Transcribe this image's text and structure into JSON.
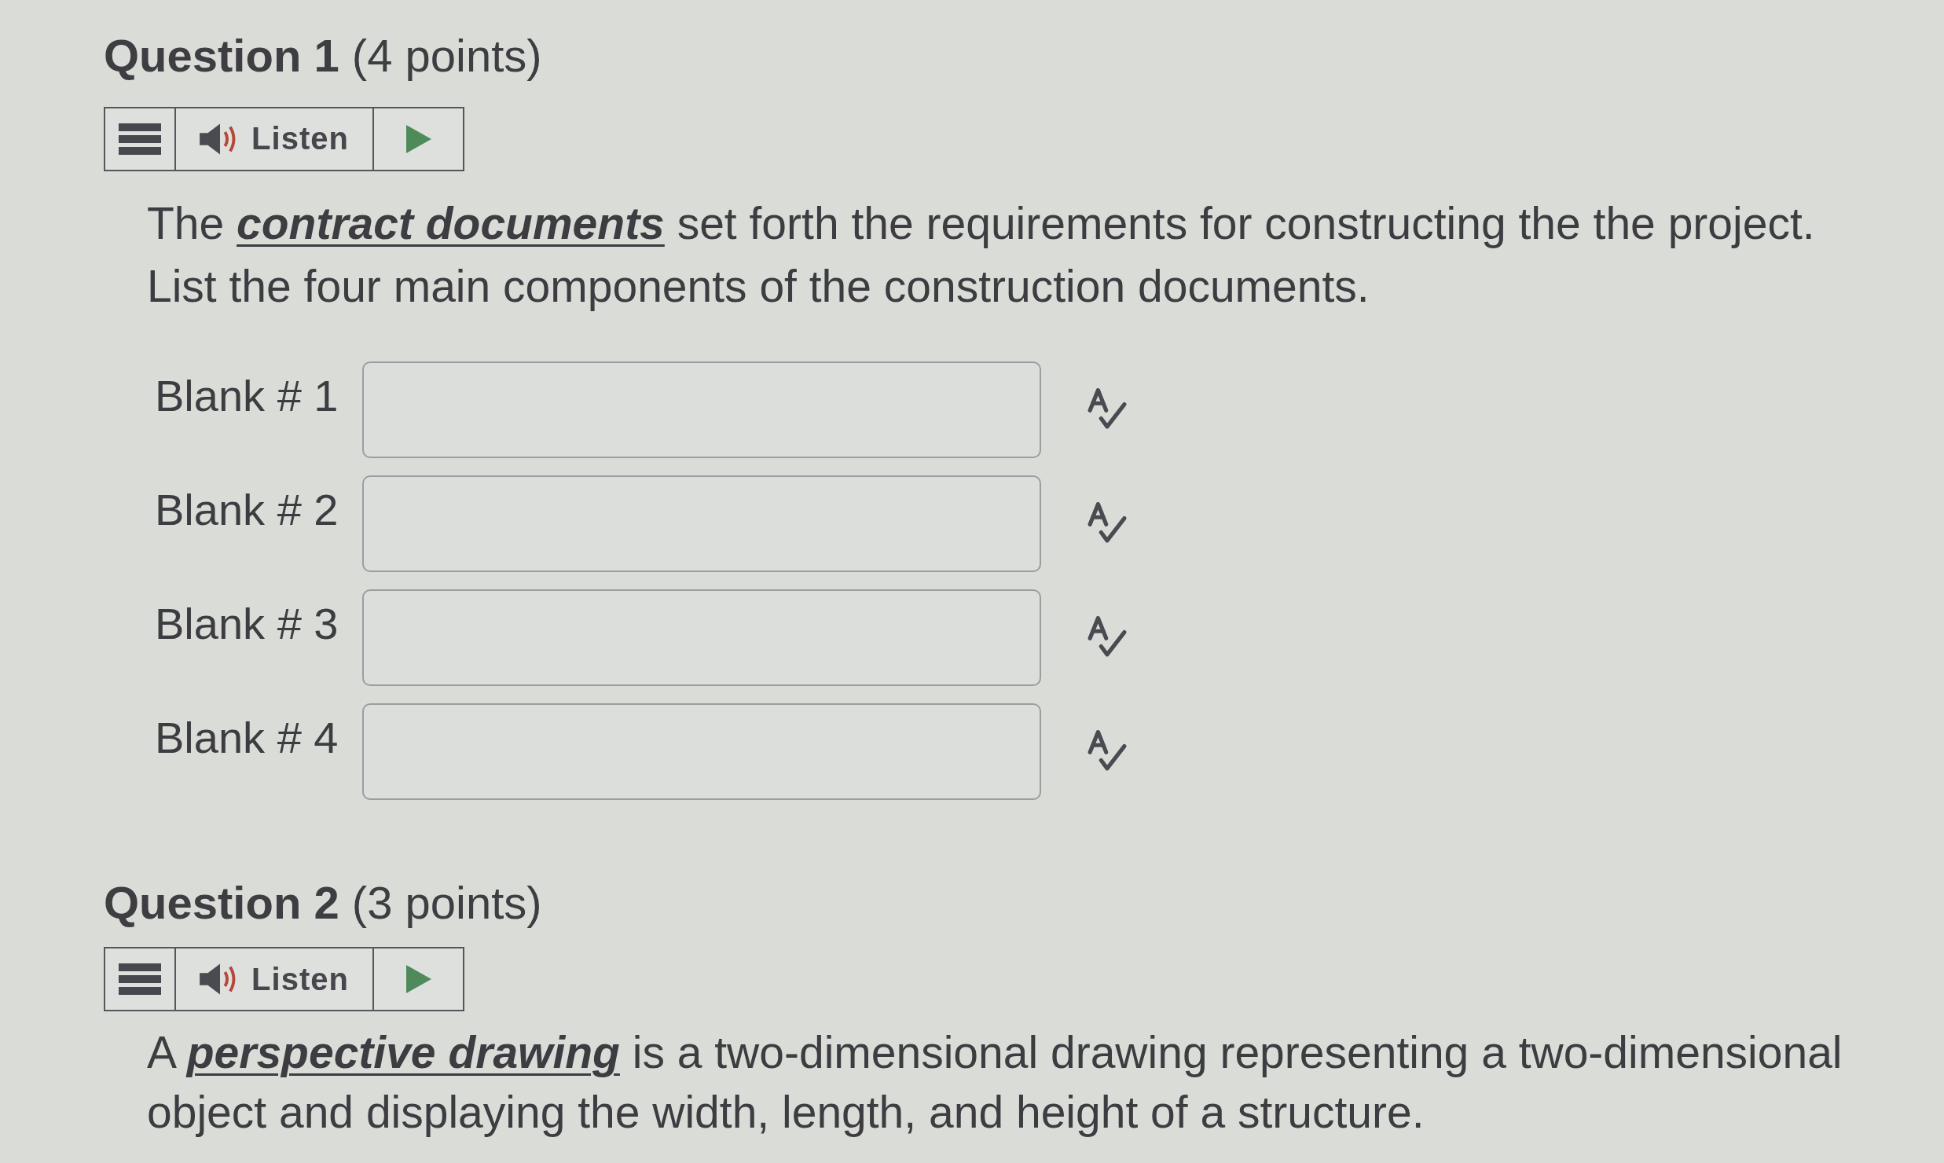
{
  "questions": [
    {
      "heading": "**Question 1** (4 points)",
      "toolbar": {
        "listen_label": "Listen"
      },
      "prompt": "The **contract documents** set forth the requirements for constructing the the project. List the four main components of the construction documents.",
      "blanks": [
        {
          "label": "Blank # 1"
        },
        {
          "label": "Blank # 2"
        },
        {
          "label": "Blank # 3"
        },
        {
          "label": "Blank # 4"
        }
      ]
    },
    {
      "heading": "**Question 2** (3 points)",
      "toolbar": {
        "listen_label": "Listen"
      },
      "prompt": "A **perspective drawing** is a two-dimensional drawing representing a two-dimensional object and displaying the width, length, and height of a structure."
    }
  ]
}
